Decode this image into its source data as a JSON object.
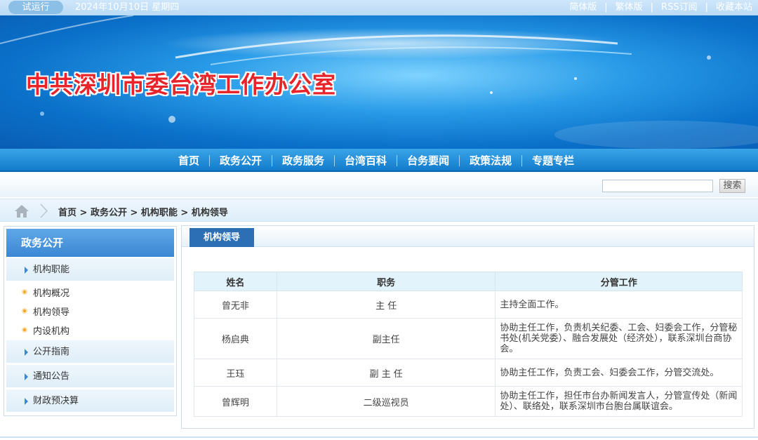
{
  "topbar": {
    "trial_label": "试运行",
    "date": "2024年10月10日 星期四",
    "links": [
      "简体版",
      "繁体版",
      "RSS订阅",
      "收藏本站"
    ]
  },
  "banner": {
    "title": "中共深圳市委台湾工作办公室"
  },
  "nav": {
    "items": [
      "首页",
      "政务公开",
      "政务服务",
      "台湾百科",
      "台务要闻",
      "政策法规",
      "专题专栏"
    ]
  },
  "search": {
    "value": "",
    "button_label": "搜索"
  },
  "breadcrumb": {
    "text": "首页 > 政务公开 > 机构职能 > 机构领导"
  },
  "sidebar": {
    "heading": "政务公开",
    "sections": [
      {
        "label": "机构职能"
      },
      {
        "label": "公开指南"
      },
      {
        "label": "通知公告"
      },
      {
        "label": "财政预决算"
      }
    ],
    "sub_items": [
      "机构概况",
      "机构领导",
      "内设机构"
    ]
  },
  "main": {
    "tab_label": "机构领导",
    "table": {
      "headers": [
        "姓名",
        "职务",
        "分管工作"
      ],
      "rows": [
        [
          "曾无非",
          "主 任",
          "主持全面工作。"
        ],
        [
          "杨启典",
          "副主任",
          "协助主任工作，负责机关纪委、工会、妇委会工作，分管秘书处(机关党委）、融合发展处（经济处），联系深圳台商协会。"
        ],
        [
          "王珏",
          "副 主 任",
          "协助主任工作，负责工会、妇委会工作，分管交流处。"
        ],
        [
          "曾辉明",
          "二级巡视员",
          "协助主任工作，担任市台办新闻发言人，分管宣传处（新闻处）、联络处，联系深圳市台胞台属联谊会。"
        ]
      ]
    }
  },
  "colors": {
    "nav_blue": "#127ccc",
    "title_red": "#e8242b",
    "tab_blue": "#2d6fb5",
    "header_bg": "#e2f3fb"
  },
  "icons": {
    "home": "home-icon",
    "chevron": "chevron-right-icon",
    "triangle": "triangle-right-icon",
    "bullet": "dot-bullet-icon"
  }
}
